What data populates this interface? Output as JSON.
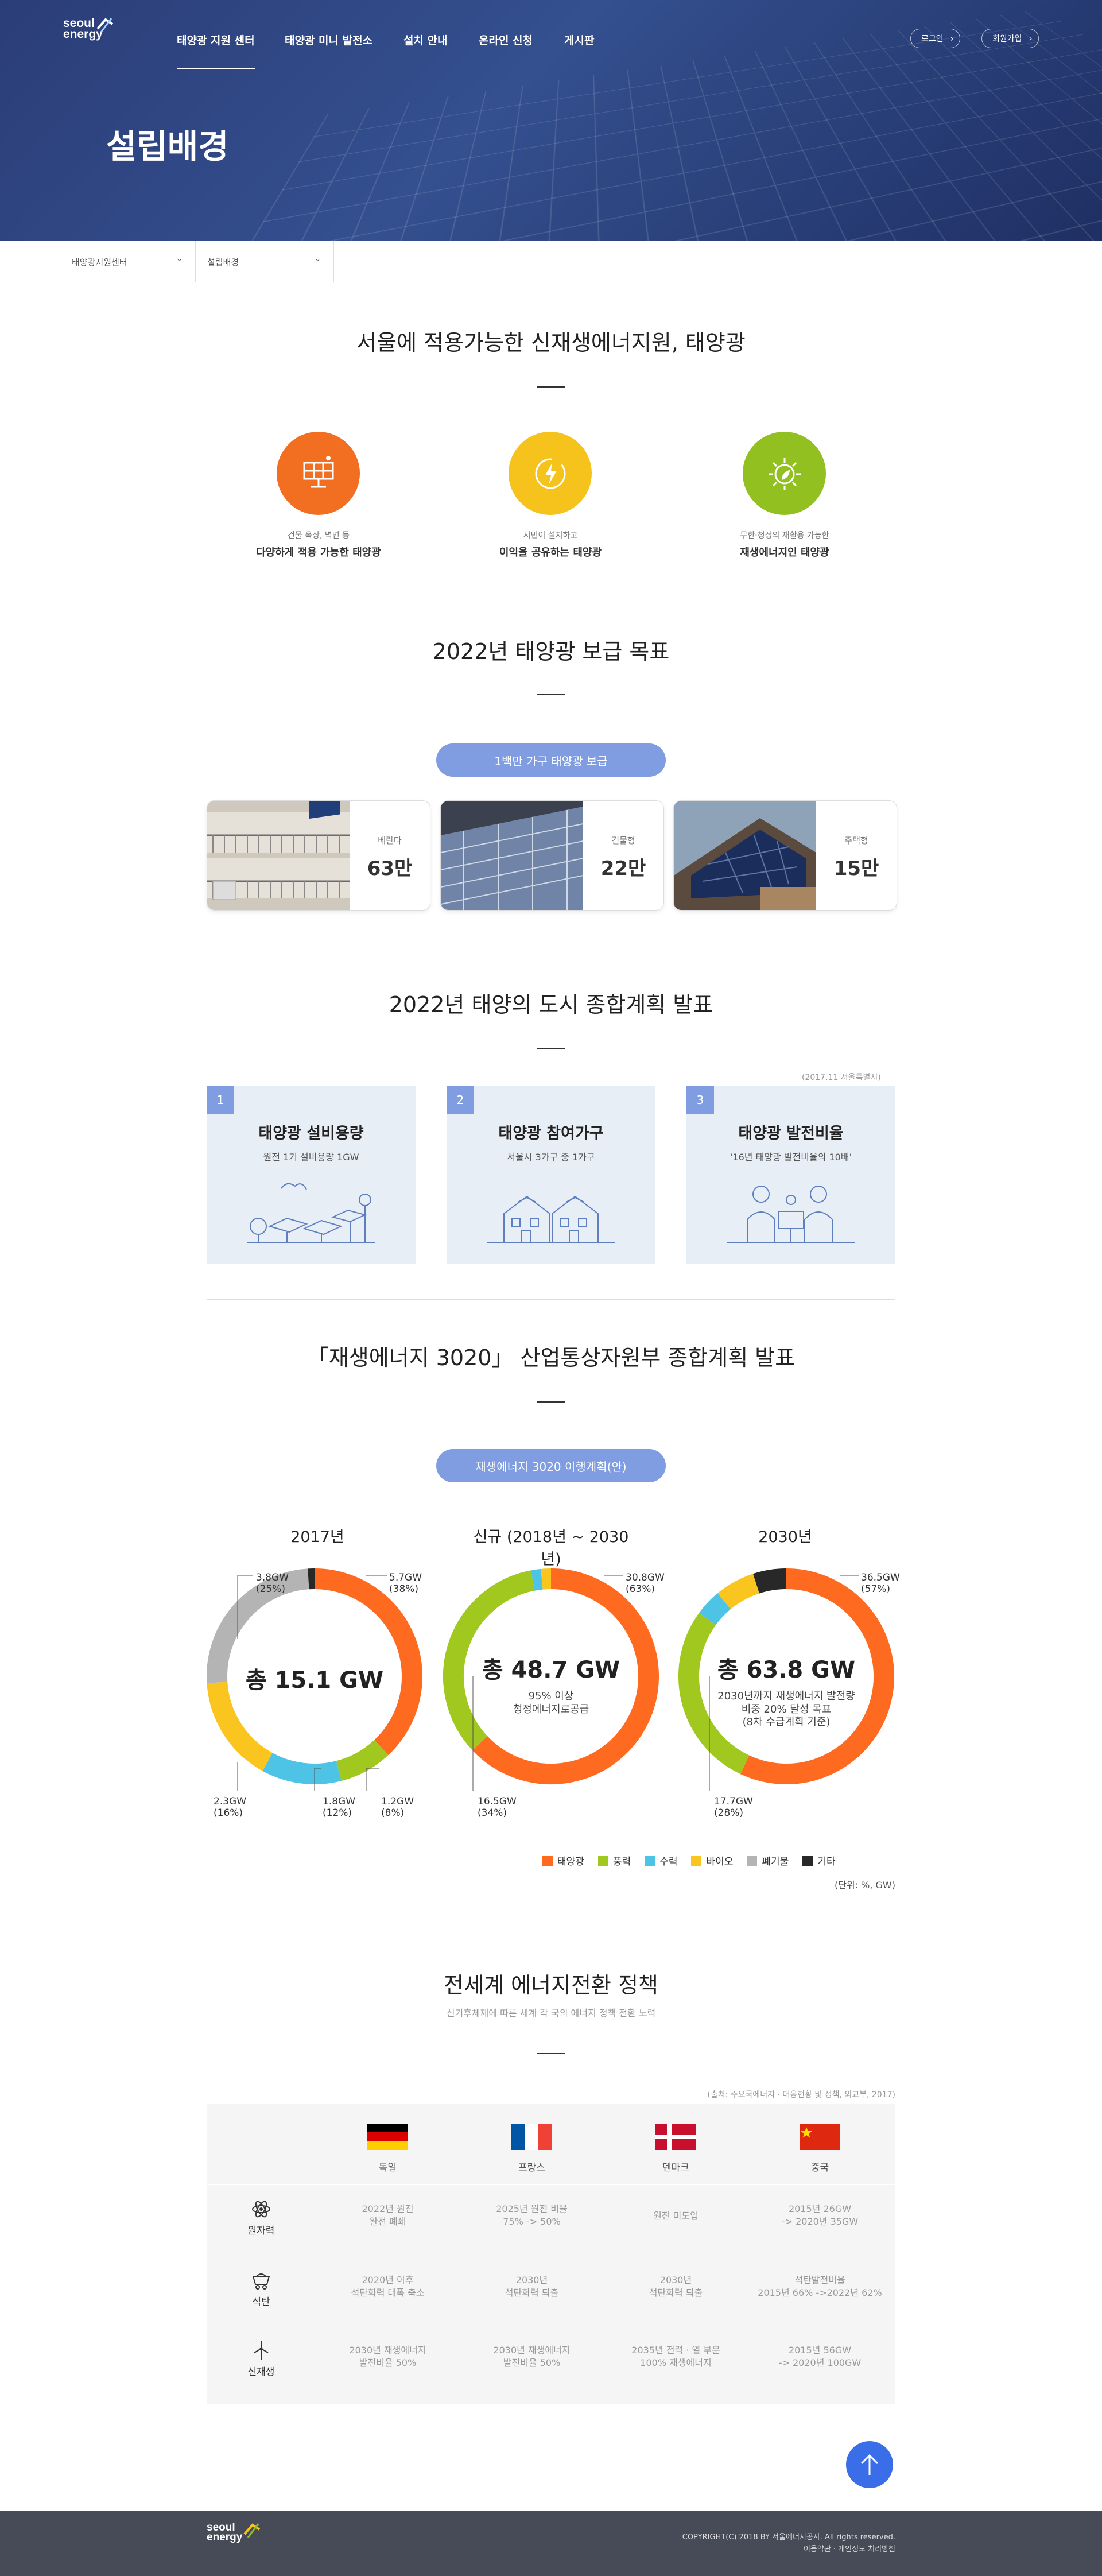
{
  "header": {
    "logo_line1": "seoul",
    "logo_line2": "energy",
    "nav": [
      "태양광 지원 센터",
      "태양광 미니 발전소",
      "설치 안내",
      "온라인 신청",
      "게시판"
    ],
    "login": "로그인",
    "signup": "회원가입",
    "page_title": "설립배경"
  },
  "breadcrumb": [
    "태양광지원센터",
    "설립배경"
  ],
  "section1": {
    "title": "서울에 적용가능한 신재생에너지원, 태양광",
    "features": [
      {
        "small": "건물 옥상, 벽면 등",
        "big": "다양하게 적용 가능한 태양광",
        "color": "#f26f21",
        "icon": "solar-panel-icon"
      },
      {
        "small": "시민이 설치하고",
        "big": "이익을 공유하는 태양광",
        "color": "#f6c21c",
        "icon": "energy-bolt-icon"
      },
      {
        "small": "무한·청정의 재활용 가능한",
        "big": "재생에너지인 태양광",
        "color": "#92c021",
        "icon": "sun-leaf-icon"
      }
    ]
  },
  "section2": {
    "title": "2022년 태양광 보급 목표",
    "pill": "1백만 가구 태양광 보급",
    "cards": [
      {
        "label": "베란다",
        "value": "63만"
      },
      {
        "label": "건물형",
        "value": "22만"
      },
      {
        "label": "주택형",
        "value": "15만"
      }
    ]
  },
  "section3": {
    "title": "2022년 태양의 도시 종합계획 발표",
    "source": "(2017.11 서울특별시)",
    "plans": [
      {
        "num": "1",
        "title": "태양광 설비용량",
        "desc": "원전 1기 설비용량 1GW"
      },
      {
        "num": "2",
        "title": "태양광 참여가구",
        "desc": "서울시 3가구 중 1가구"
      },
      {
        "num": "3",
        "title": "태양광 발전비율",
        "desc": "'16년 태양광 발전비율의 10배'"
      }
    ]
  },
  "section4": {
    "title": "「재생에너지 3020」 산업통상자원부 종합계획 발표",
    "pill": "재생에너지 3020 이행계획(안)",
    "unit": "(단위: %, GW)"
  },
  "chart_data": [
    {
      "type": "pie",
      "title": "2017년",
      "center_total": "총 15.1 GW",
      "center_sub": [],
      "categories": [
        "태양광",
        "풍력",
        "수력",
        "바이오",
        "폐기물",
        "기타"
      ],
      "values": [
        38,
        8,
        12,
        16,
        25,
        1
      ],
      "callouts": [
        {
          "value": "5.7GW",
          "share": "(38%)"
        },
        {
          "value": "1.2GW",
          "share": "(8%)"
        },
        {
          "value": "1.8GW",
          "share": "(12%)"
        },
        {
          "value": "2.3GW",
          "share": "(16%)"
        },
        {
          "value": "3.8GW",
          "share": "(25%)"
        }
      ]
    },
    {
      "type": "pie",
      "title": "신규 (2018년 ~ 2030년)",
      "center_total": "총 48.7 GW",
      "center_sub": [
        "95% 이상",
        "청정에너지로공급"
      ],
      "categories": [
        "태양광",
        "풍력",
        "수력",
        "바이오",
        "폐기물",
        "기타"
      ],
      "values": [
        63,
        34,
        1.5,
        1.5,
        0,
        0
      ],
      "callouts": [
        {
          "value": "30.8GW",
          "share": "(63%)"
        },
        {
          "value": "16.5GW",
          "share": "(34%)"
        }
      ]
    },
    {
      "type": "pie",
      "title": "2030년",
      "center_total": "총 63.8 GW",
      "center_sub": [
        "2030년까지 재생에너지 발전량",
        "비중 20% 달성 목표",
        "(8차 수급계획 기준)"
      ],
      "categories": [
        "태양광",
        "풍력",
        "수력",
        "바이오",
        "폐기물",
        "기타"
      ],
      "values": [
        57,
        28,
        4,
        6,
        0,
        5
      ],
      "callouts": [
        {
          "value": "36.5GW",
          "share": "(57%)"
        },
        {
          "value": "17.7GW",
          "share": "(28%)"
        }
      ]
    }
  ],
  "legend": [
    {
      "name": "태양광",
      "color": "#ff6a21"
    },
    {
      "name": "풍력",
      "color": "#a0c81e"
    },
    {
      "name": "수력",
      "color": "#4dc3e6"
    },
    {
      "name": "바이오",
      "color": "#f9c51e"
    },
    {
      "name": "폐기물",
      "color": "#b4b4b4"
    },
    {
      "name": "기타",
      "color": "#282828"
    }
  ],
  "section5": {
    "title": "전세계 에너지전환 정책",
    "subtitle": "신기후체제에 따른 세계 각 국의 에너지 정책 전환 노력",
    "source": "(출처: 주요국에너지 · 대응현황 및 정책, 외교부, 2017)",
    "countries": [
      "독일",
      "프랑스",
      "덴마크",
      "중국"
    ],
    "rows": [
      {
        "label": "원자력",
        "icon": "atom-icon",
        "cells": [
          [
            "2022년 원전",
            "완전 폐쇄"
          ],
          [
            "2025년 원전 비율",
            "75% -> 50%"
          ],
          [
            "원전 미도입"
          ],
          [
            "2015년 26GW",
            "-> 2020년 35GW"
          ]
        ]
      },
      {
        "label": "석탄",
        "icon": "coal-cart-icon",
        "cells": [
          [
            "2020년 이후",
            "석탄화력 대폭 축소"
          ],
          [
            "2030년",
            "석탄화력 퇴출"
          ],
          [
            "2030년",
            "석탄화력 퇴출"
          ],
          [
            "석탄발전비율",
            "2015년 66% ->2022년 62%"
          ]
        ]
      },
      {
        "label": "신재생",
        "icon": "wind-turbine-icon",
        "cells": [
          [
            "2030년 재생에너지",
            "발전비율 50%"
          ],
          [
            "2030년 재생에너지",
            "발전비율 50%"
          ],
          [
            "2035년 전력 · 열 부문",
            "100% 재생에너지"
          ],
          [
            "2015년 56GW",
            "-> 2020년 100GW"
          ]
        ]
      }
    ]
  },
  "footer": {
    "copyright": "COPYRIGHT(C) 2018 BY 서울에너지공사. All rights reserved.",
    "links": "이용약관  ·  개인정보 처리방침"
  }
}
